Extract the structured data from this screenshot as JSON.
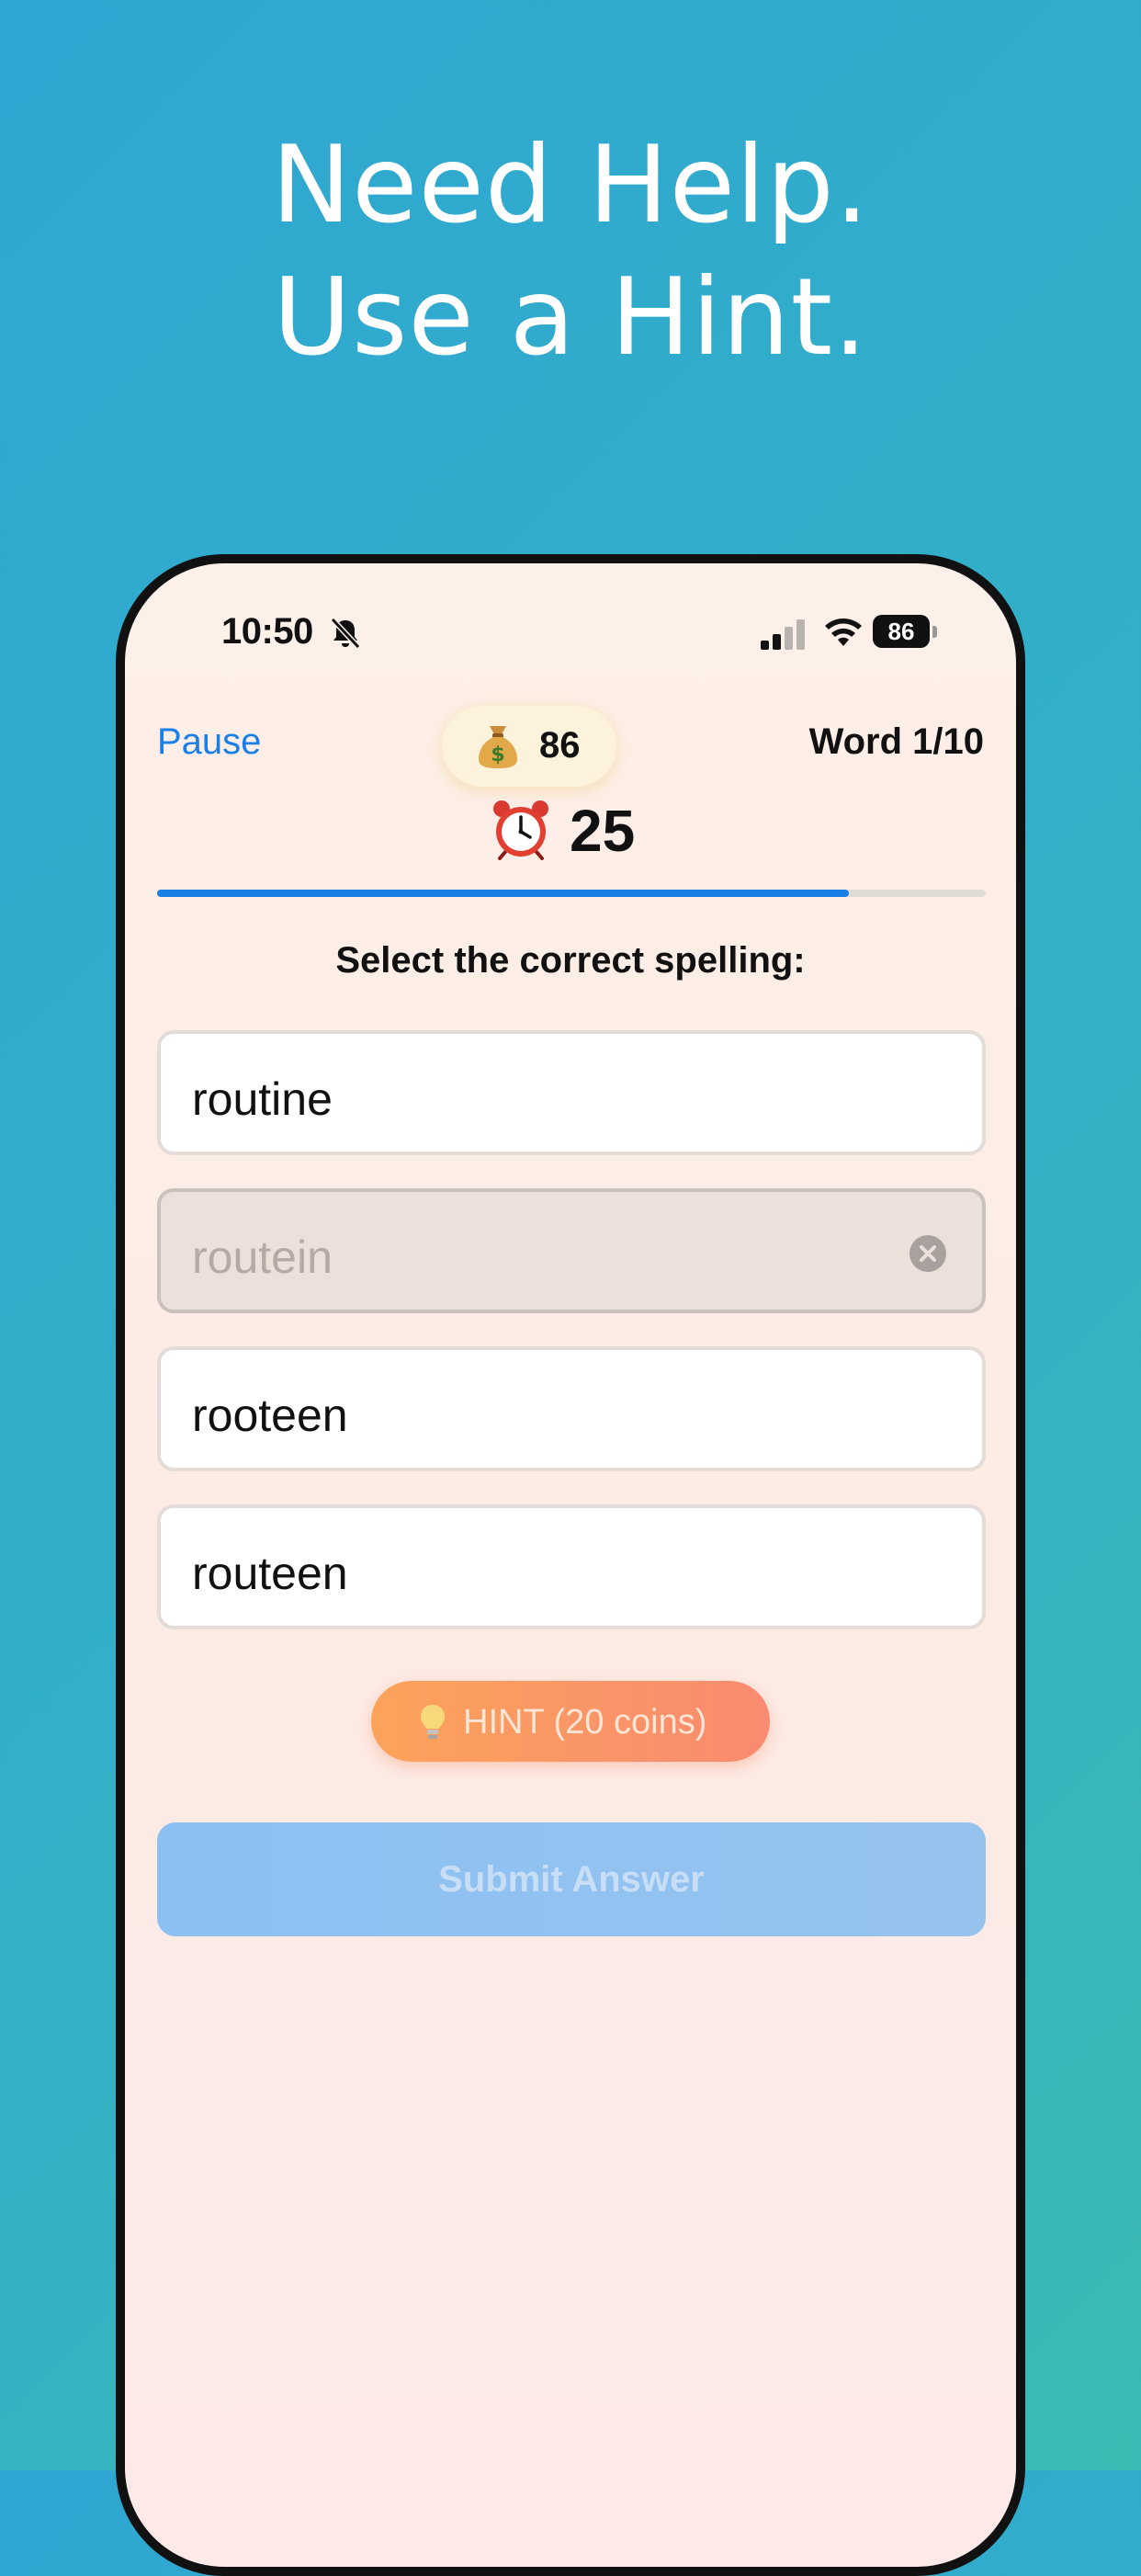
{
  "promo": {
    "line1": "Need Help.",
    "line2": "Use a Hint."
  },
  "status_bar": {
    "time": "10:50",
    "battery": "86",
    "icons": [
      "bell-slash-icon",
      "signal-icon",
      "wifi-icon",
      "battery-icon"
    ]
  },
  "header": {
    "pause_label": "Pause",
    "coins": "86",
    "coins_icon": "money-bag-icon",
    "word_counter": "Word 1/10"
  },
  "timer": {
    "icon": "alarm-clock-icon",
    "value": "25"
  },
  "progress": {
    "fraction": 0.835,
    "color": "#1a7fe6"
  },
  "quiz": {
    "prompt": "Select the correct spelling:",
    "options": [
      {
        "label": "routine",
        "eliminated": false
      },
      {
        "label": "routein",
        "eliminated": true
      },
      {
        "label": "rooteen",
        "eliminated": false
      },
      {
        "label": "routeen",
        "eliminated": false
      }
    ]
  },
  "hint": {
    "icon": "lightbulb-icon",
    "label": "HINT (20 coins)"
  },
  "submit": {
    "label": "Submit Answer",
    "enabled": false
  },
  "colors": {
    "accent": "#1a7fe6",
    "hint_gradient_start": "#fba35b",
    "hint_gradient_end": "#fa8a70"
  }
}
